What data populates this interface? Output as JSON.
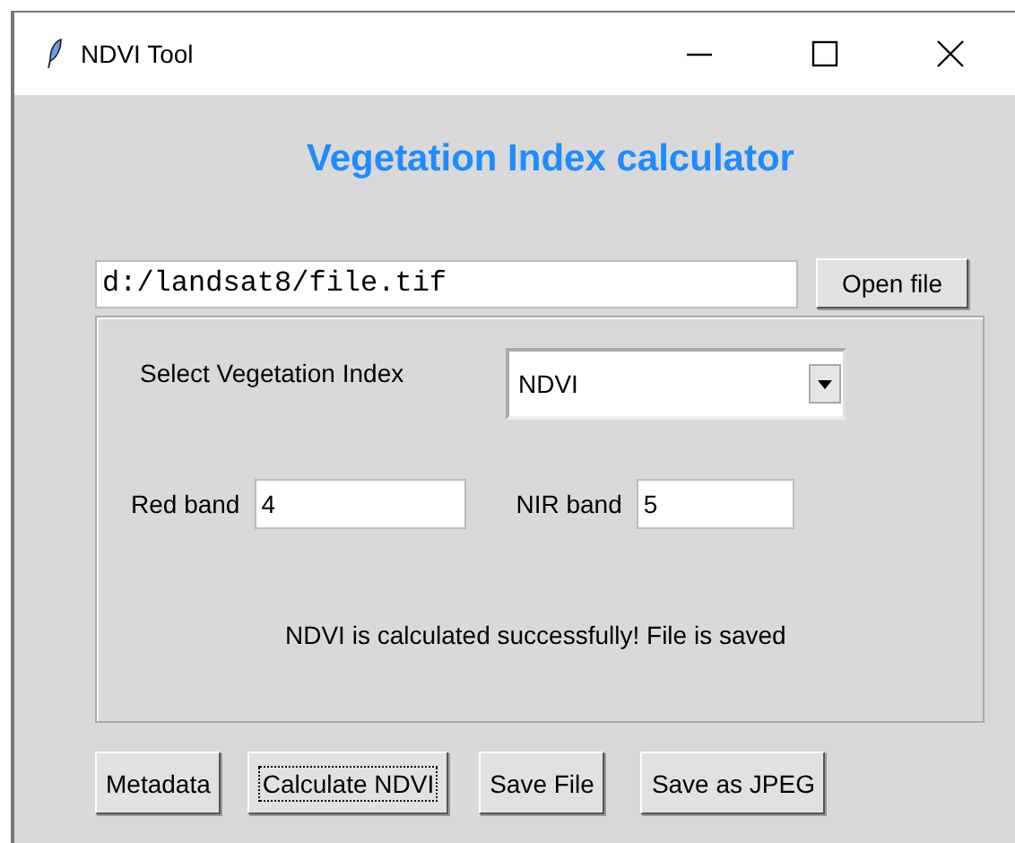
{
  "window": {
    "title": "NDVI Tool"
  },
  "heading": "Vegetation Index calculator",
  "file_path": {
    "value": "d:/landsat8/file.tif"
  },
  "open_button": "Open file",
  "index_select": {
    "label": "Select Vegetation Index",
    "value": "NDVI"
  },
  "red_band": {
    "label": "Red band",
    "value": "4"
  },
  "nir_band": {
    "label": "NIR band",
    "value": "5"
  },
  "message": "NDVI is calculated successfully! File is saved",
  "buttons": [
    {
      "label": "Metadata",
      "focused": false
    },
    {
      "label": "Calculate NDVI",
      "focused": true
    },
    {
      "label": "Save File",
      "focused": false
    },
    {
      "label": "Save as JPEG",
      "focused": false
    }
  ]
}
